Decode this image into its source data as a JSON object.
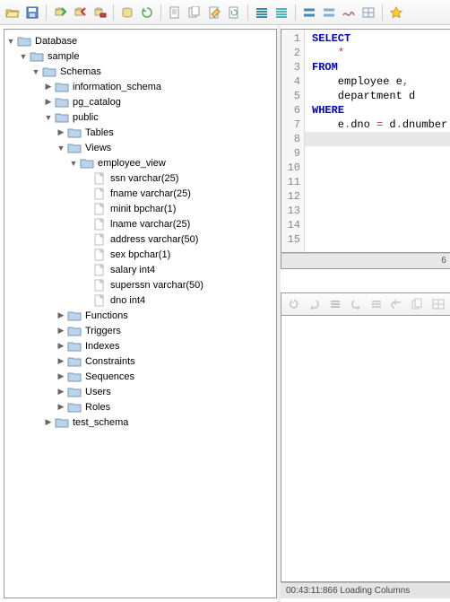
{
  "toolbar_icons": [
    "folder-open",
    "save",
    "sep",
    "db-connect-green",
    "db-disconnect-red",
    "db-remove",
    "sep",
    "db-cyl",
    "recycle",
    "sep",
    "doc",
    "doc-copy",
    "doc-edit",
    "doc-refresh",
    "sep",
    "lines-blue",
    "lines-cyan",
    "sep",
    "lines-2",
    "lines-2b",
    "scribble",
    "lines-grid",
    "sep",
    "star"
  ],
  "tree": [
    {
      "d": 0,
      "t": "open",
      "i": "folder",
      "label": "Database"
    },
    {
      "d": 1,
      "t": "open",
      "i": "folder",
      "label": "sample"
    },
    {
      "d": 2,
      "t": "open",
      "i": "folder",
      "label": "Schemas"
    },
    {
      "d": 3,
      "t": "closed",
      "i": "folder",
      "label": "information_schema"
    },
    {
      "d": 3,
      "t": "closed",
      "i": "folder",
      "label": "pg_catalog"
    },
    {
      "d": 3,
      "t": "open",
      "i": "folder",
      "label": "public"
    },
    {
      "d": 4,
      "t": "closed",
      "i": "folder",
      "label": "Tables"
    },
    {
      "d": 4,
      "t": "open",
      "i": "folder",
      "label": "Views"
    },
    {
      "d": 5,
      "t": "open",
      "i": "folder",
      "label": "employee_view"
    },
    {
      "d": 6,
      "t": "none",
      "i": "col",
      "label": "ssn varchar(25)"
    },
    {
      "d": 6,
      "t": "none",
      "i": "col",
      "label": "fname varchar(25)"
    },
    {
      "d": 6,
      "t": "none",
      "i": "col",
      "label": "minit bpchar(1)"
    },
    {
      "d": 6,
      "t": "none",
      "i": "col",
      "label": "lname varchar(25)"
    },
    {
      "d": 6,
      "t": "none",
      "i": "col",
      "label": "address varchar(50)"
    },
    {
      "d": 6,
      "t": "none",
      "i": "col",
      "label": "sex bpchar(1)"
    },
    {
      "d": 6,
      "t": "none",
      "i": "col",
      "label": "salary int4"
    },
    {
      "d": 6,
      "t": "none",
      "i": "col",
      "label": "superssn varchar(50)"
    },
    {
      "d": 6,
      "t": "none",
      "i": "col",
      "label": "dno int4"
    },
    {
      "d": 4,
      "t": "closed",
      "i": "folder",
      "label": "Functions"
    },
    {
      "d": 4,
      "t": "closed",
      "i": "folder",
      "label": "Triggers"
    },
    {
      "d": 4,
      "t": "closed",
      "i": "folder",
      "label": "Indexes"
    },
    {
      "d": 4,
      "t": "closed",
      "i": "folder",
      "label": "Constraints"
    },
    {
      "d": 4,
      "t": "closed",
      "i": "folder",
      "label": "Sequences"
    },
    {
      "d": 4,
      "t": "closed",
      "i": "folder",
      "label": "Users"
    },
    {
      "d": 4,
      "t": "closed",
      "i": "folder",
      "label": "Roles"
    },
    {
      "d": 3,
      "t": "closed",
      "i": "folder",
      "label": "test_schema"
    }
  ],
  "sql_lines": [
    {
      "n": 1,
      "html": "<span class='kw'>SELECT</span>"
    },
    {
      "n": 2,
      "html": "    <span class='star'>*</span>"
    },
    {
      "n": 3,
      "html": "<span class='kw'>FROM</span>"
    },
    {
      "n": 4,
      "html": "    employee e<span class='op'>,</span>"
    },
    {
      "n": 5,
      "html": "    department d"
    },
    {
      "n": 6,
      "html": "<span class='kw'>WHERE</span>"
    },
    {
      "n": 7,
      "html": "    e<span class='op'>.</span>dno <span class='op'>=</span> d<span class='op'>.</span>dnumber"
    },
    {
      "n": 8,
      "html": "",
      "cursor": true
    },
    {
      "n": 9,
      "html": ""
    },
    {
      "n": 10,
      "html": ""
    },
    {
      "n": 11,
      "html": ""
    },
    {
      "n": 12,
      "html": ""
    },
    {
      "n": 13,
      "html": ""
    },
    {
      "n": 14,
      "html": ""
    },
    {
      "n": 15,
      "html": ""
    }
  ],
  "hscroll_label": "6",
  "results_toolbar": [
    "refresh",
    "undo",
    "bars",
    "redo",
    "indent",
    "undo2",
    "copy",
    "grid"
  ],
  "status_text": "00:43:11:866 Loading Columns"
}
